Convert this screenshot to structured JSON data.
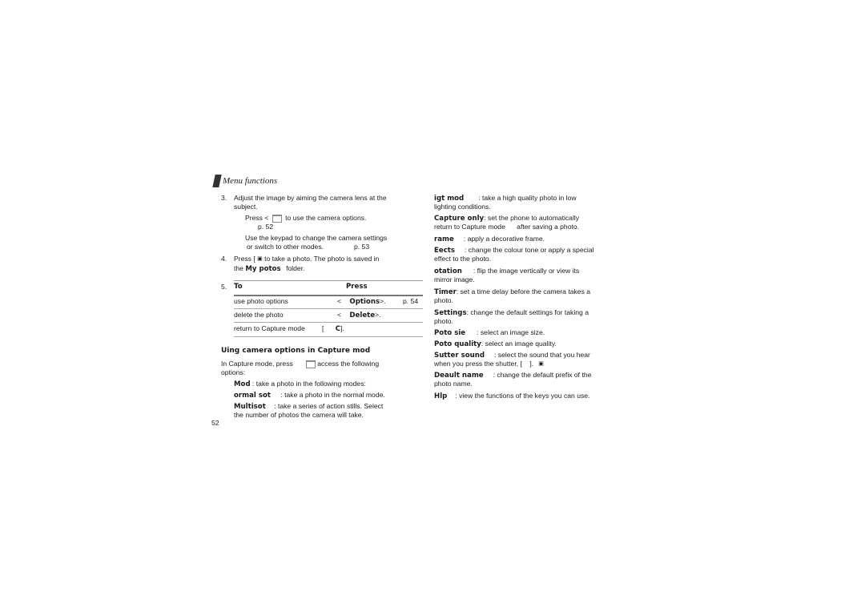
{
  "header": {
    "title": "Menu functions"
  },
  "left": {
    "step3": {
      "num": "3.",
      "line1": "Adjust the image by aiming the camera lens at the",
      "line2": "subject.",
      "sub1_a": "Press <",
      "sub1_b": "to use the camera options.",
      "sub1_ref": "p. 52",
      "sub2_line1": "Use the keypad to change the camera settings",
      "sub2_line2": "or switch to other modes.",
      "sub2_ref": "p. 53"
    },
    "step4": {
      "num": "4.",
      "line1_a": "Press [",
      "line1_b": "to take a photo. The photo is saved in",
      "line2_a": "the",
      "line2_bold": "My potos",
      "line2_b": "folder."
    },
    "step5": {
      "num": "5.",
      "table": {
        "headers": [
          "To",
          "Press"
        ],
        "rows": [
          {
            "to": "use photo options",
            "press_prefix": "<",
            "press_bold": "Options",
            "press_suffix": ">.",
            "ref": "p. 54"
          },
          {
            "to": "delete the photo",
            "press_prefix": "<",
            "press_bold": "Delete",
            "press_suffix": ">.",
            "ref": ""
          },
          {
            "to": "return to Capture mode",
            "press_prefix": "[",
            "press_bold": "C",
            "press_suffix": "].",
            "ref": ""
          }
        ]
      }
    },
    "section": {
      "title": "Uing camera options in Capture mod",
      "intro_a": "In Capture mode, press",
      "intro_b": "access the following",
      "intro_c": "options:",
      "items": [
        {
          "term": "Mod",
          "desc": ": take a photo in the following modes:"
        },
        {
          "term": "ormal sot",
          "desc": ": take a photo in the normal mode."
        },
        {
          "term": "Multisot",
          "desc": ": take a series of action stills. Select",
          "desc2": "the number of photos the camera will take."
        }
      ]
    },
    "page_number": "52"
  },
  "right": {
    "items": [
      {
        "term": "igt mod",
        "desc": ": take a high quality photo in low",
        "desc2": "lighting conditions."
      },
      {
        "term": "Capture only",
        "desc": ": set the phone to automatically",
        "desc2": "return to Capture mode      after saving a photo."
      },
      {
        "term": "rame",
        "desc": ": apply a decorative frame."
      },
      {
        "term": "Eects",
        "desc": ": change the colour tone or apply a special",
        "desc2": "effect to the photo."
      },
      {
        "term": "otation",
        "desc": ": flip the image vertically or view its",
        "desc2": "mirror image."
      },
      {
        "term": "Timer",
        "desc": ": set a time delay before the camera takes a",
        "desc2": "photo."
      },
      {
        "term": "Settings",
        "desc": ": change the default settings for taking a",
        "desc2": "photo."
      },
      {
        "term": "Poto sie",
        "desc": ": select an image size."
      },
      {
        "term": "Poto quality",
        "desc": ": select an image quality."
      },
      {
        "term": "Sutter sound",
        "desc": ": select the sound that you hear",
        "desc2": "when you press the shutter, [    ]."
      },
      {
        "term": "Deault name",
        "desc": ": change the default prefix of the",
        "desc2": "photo name."
      },
      {
        "term": "Hlp",
        "desc": ": view the functions of the keys you can use."
      }
    ]
  }
}
